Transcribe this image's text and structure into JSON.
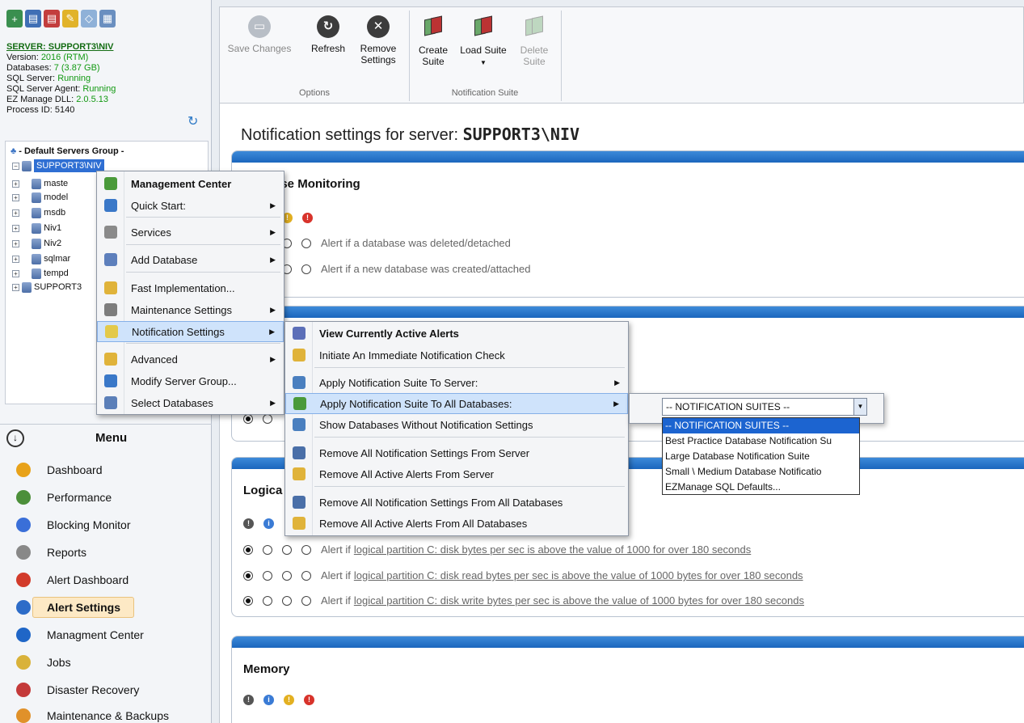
{
  "server": {
    "title": "SERVER: SUPPORT3\\NIV",
    "version_label": "Version:",
    "version": "2016 (RTM)",
    "databases_label": "Databases:",
    "databases": "7 (3.87 GB)",
    "sql_server_label": "SQL Server:",
    "sql_server": "Running",
    "agent_label": "SQL Server Agent:",
    "agent": "Running",
    "dll_label": "EZ Manage DLL:",
    "dll": "2.0.5.13",
    "pid_label": "Process ID:",
    "pid": "5140"
  },
  "tree": {
    "group": "- Default Servers Group -",
    "server": "SUPPORT3\\NIV",
    "dbs": [
      "maste",
      "model",
      "msdb",
      "Niv1",
      "Niv2",
      "sqlmar",
      "tempd"
    ],
    "server2": "SUPPORT3"
  },
  "menu": {
    "title": "Menu",
    "items": [
      "Dashboard",
      "Performance",
      "Blocking Monitor",
      "Reports",
      "Alert Dashboard",
      "Alert Settings",
      "Managment Center",
      "Jobs",
      "Disaster Recovery",
      "Maintenance & Backups"
    ],
    "icon_colors": [
      "#e8a21a",
      "#4c8f3a",
      "#3a6fd8",
      "#888888",
      "#d23b2b",
      "#2d6cc8",
      "#1f66c7",
      "#d9b23a",
      "#c43a3a",
      "#e0912a"
    ]
  },
  "context_menu": {
    "items": [
      "Management Center",
      "Quick Start:",
      "Services",
      "Add Database",
      "Fast Implementation...",
      "Maintenance Settings",
      "Notification Settings",
      "Advanced",
      "Modify Server Group...",
      "Select Databases"
    ]
  },
  "submenu": {
    "items": [
      "View Currently Active Alerts",
      "Initiate An Immediate Notification Check",
      "Apply Notification Suite To Server:",
      "Apply Notification Suite To All Databases:",
      "Show Databases Without Notification Settings",
      "Remove All Notification Settings From Server",
      "Remove All Active Alerts From Server",
      "Remove All Notification Settings From All Databases",
      "Remove All Active Alerts From All Databases"
    ]
  },
  "suite_dropdown": {
    "selected": "-- NOTIFICATION SUITES --",
    "options": [
      "-- NOTIFICATION SUITES --",
      "Best Practice Database Notification Su",
      "Large Database Notification Suite",
      "Small \\ Medium Database Notificatio",
      "EZManage SQL Defaults..."
    ]
  },
  "ribbon": {
    "save": "Save Changes",
    "refresh": "Refresh",
    "remove_l1": "Remove",
    "remove_l2": "Settings",
    "create_l1": "Create",
    "create_l2": "Suite",
    "load": "Load Suite",
    "delete_l1": "Delete",
    "delete_l2": "Suite",
    "group_options": "Options",
    "group_suite": "Notification Suite"
  },
  "main": {
    "title_prefix": "Notification settings for server: ",
    "title_server": "SUPPORT3\\NIV",
    "db_monitoring": "ase Monitoring",
    "db_row1": "Alert if a database was deleted/detached",
    "db_row2": "Alert if a new database was created/attached",
    "logical": "Logica",
    "alert_if": "Alert if",
    "disk_row1": "logical partition C: disk bytes per sec is above the value of 1000 for over 180 seconds",
    "disk_row2": "logical partition C: disk read bytes per sec is above the value of 1000 bytes for over 180 seconds",
    "disk_row3": "logical partition C: disk write bytes per sec is above the value of 1000 bytes for over 180 seconds",
    "memory": "Memory"
  }
}
